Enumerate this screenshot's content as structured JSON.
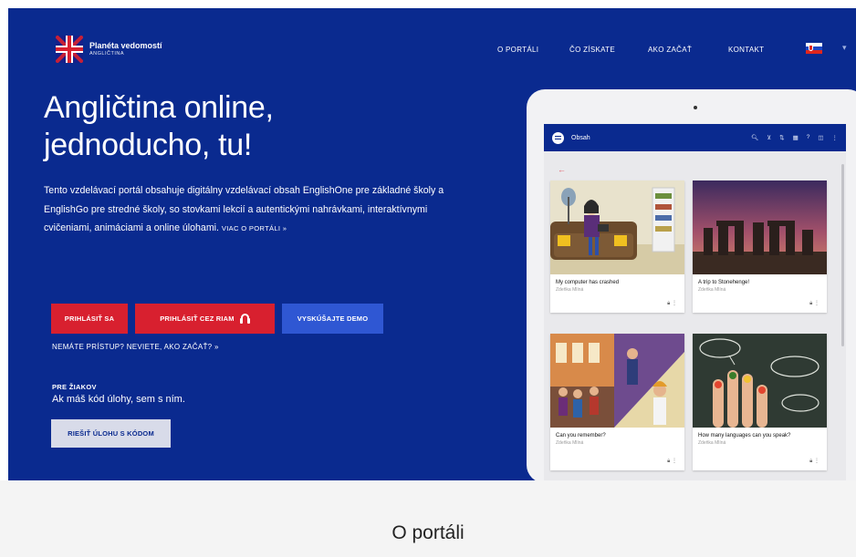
{
  "brand": {
    "name": "Planéta vedomostí",
    "subtitle": "ANGLIČTINA"
  },
  "nav": {
    "items": [
      "O PORTÁLI",
      "ČO ZÍSKATE",
      "AKO ZAČAŤ",
      "KONTAKT"
    ],
    "language": "sk"
  },
  "hero": {
    "headline_line1": "Angličtina online,",
    "headline_line2": "jednoducho, tu!",
    "intro": "Tento vzdelávací portál obsahuje digitálny vzdelávací obsah EnglishOne pre základné školy a EnglishGo pre stredné školy, so stovkami lekcií a autentickými nahrávkami, interaktívnymi cvičeniami, animáciami a online úlohami.",
    "intro_more": "VIAC O PORTÁLI »",
    "buttons": {
      "login": "PRIHLÁSIŤ SA",
      "login_rham": "PRIHLÁSIŤ CEZ RIAM",
      "demo": "VYSKÚŠAJTE DEMO"
    },
    "no_access": "NEMÁTE PRÍSTUP? NEVIETE, AKO ZAČAŤ? »",
    "pupils_title": "PRE ŽIAKOV",
    "pupils_text": "Ak máš kód úlohy, sem s ním.",
    "solve_button": "RIEŠIŤ ÚLOHU S KÓDOM"
  },
  "tablet": {
    "app_title": "Obsah",
    "back_arrow": "←",
    "cards": [
      {
        "title": "My computer has crashed",
        "author": "Zdeňka Mlíná"
      },
      {
        "title": "A trip to Stonehenge!",
        "author": "Zdeňka Mlíná"
      },
      {
        "title": "Can you remember?",
        "author": "Zdeňka Mlíná"
      },
      {
        "title": "How many languages can you speak?",
        "author": "Zdeňka Mlíná"
      }
    ],
    "card_icons": [
      "lock-icon",
      "more-vertical-icon"
    ]
  },
  "section": {
    "title": "O portáli"
  },
  "colors": {
    "hero_bg": "#0a2a8f",
    "red": "#d8202f",
    "blue_button": "#2f57d3"
  }
}
